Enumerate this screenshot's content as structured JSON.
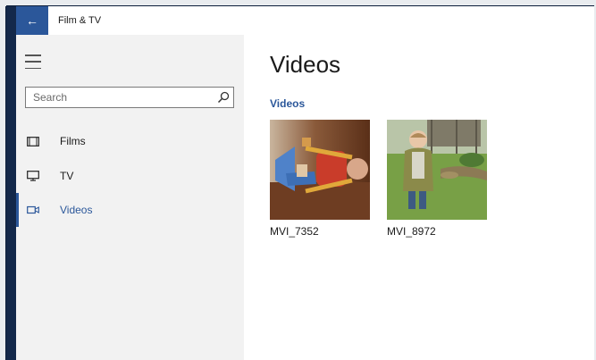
{
  "window": {
    "title": "Film & TV"
  },
  "sidebar": {
    "search_placeholder": "Search",
    "items": [
      {
        "label": "Films",
        "icon": "film-icon",
        "selected": false
      },
      {
        "label": "TV",
        "icon": "tv-icon",
        "selected": false
      },
      {
        "label": "Videos",
        "icon": "video-camera-icon",
        "selected": true
      }
    ]
  },
  "main": {
    "title": "Videos",
    "section_title": "Videos",
    "videos": [
      {
        "name": "MVI_7352"
      },
      {
        "name": "MVI_8972"
      }
    ]
  },
  "colors": {
    "accent": "#2b579a",
    "sidebar_bg": "#f2f2f2",
    "frame": "#13284a"
  }
}
